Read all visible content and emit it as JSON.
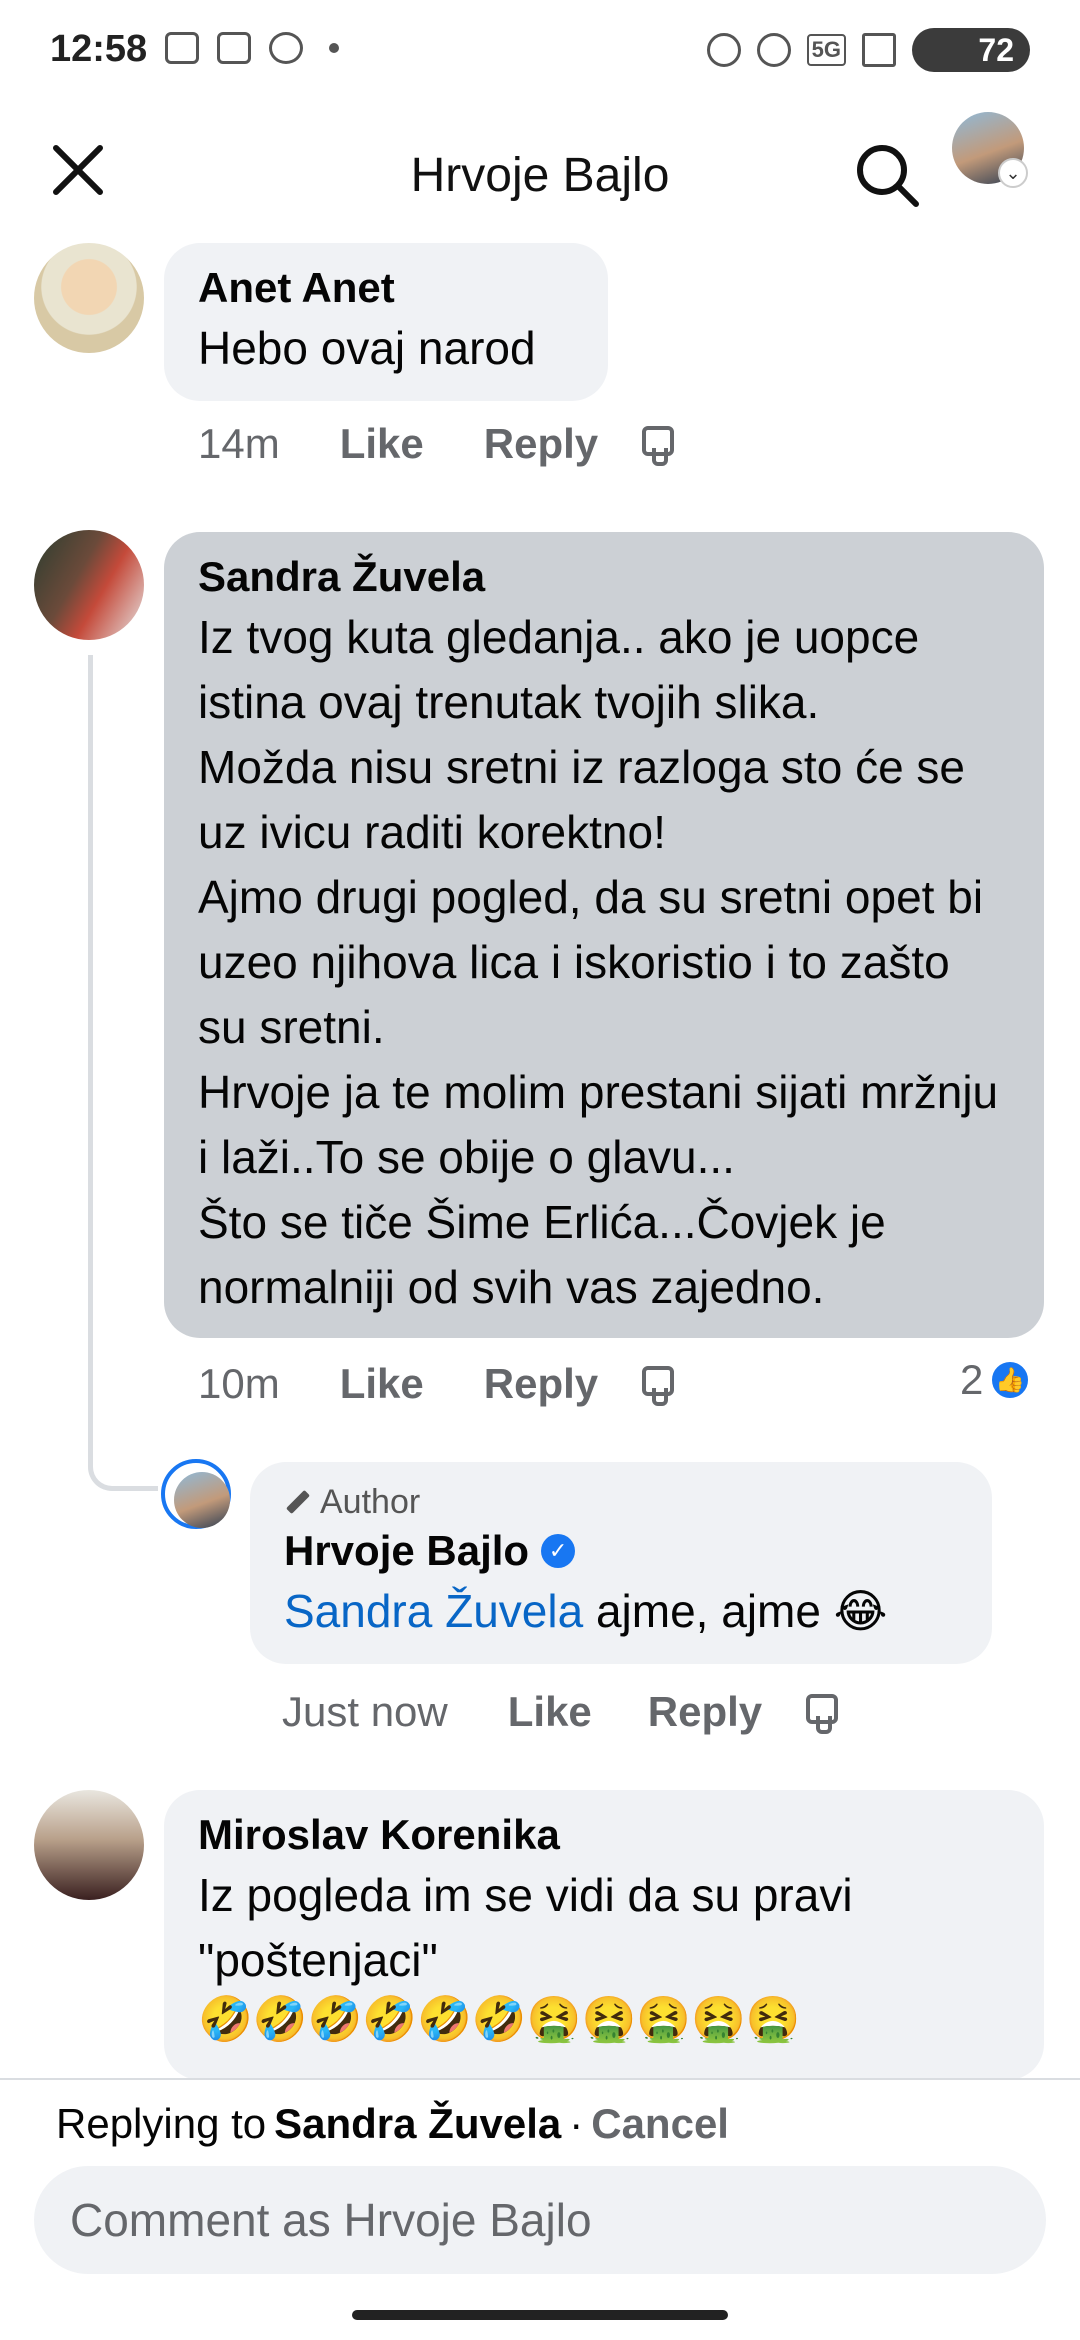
{
  "status_bar": {
    "time": "12:58",
    "battery": "72",
    "network_label": "5G"
  },
  "header": {
    "title": "Hrvoje Bajlo"
  },
  "comments": [
    {
      "author": "Anet Anet",
      "text": "Hebo ovaj narod",
      "time": "14m",
      "like_label": "Like",
      "reply_label": "Reply"
    },
    {
      "author": "Sandra Žuvela",
      "text": "Iz tvog kuta gledanja.. ako je uopce istina ovaj trenutak tvojih slika.\nMožda nisu sretni iz razloga sto će se uz ivicu raditi korektno!\nAjmo drugi pogled, da su sretni opet bi uzeo njihova lica i iskoristio i to zašto su sretni.\nHrvoje ja te molim prestani sijati mržnju i laži..To se obije o glavu...\nŠto se tiče Šime Erlića...Čovjek  je normalniji od svih vas zajedno.",
      "time": "10m",
      "like_label": "Like",
      "reply_label": "Reply",
      "reaction_count": "2"
    },
    {
      "badge": "Author",
      "author": "Hrvoje Bajlo",
      "mention": "Sandra Žuvela",
      "text": " ajme, ajme 😂",
      "time": "Just now",
      "like_label": "Like",
      "reply_label": "Reply"
    },
    {
      "author": "Miroslav Korenika",
      "text": "Iz pogleda im se vidi da su pravi \"poštenjaci\"",
      "emojis": "🤣🤣🤣🤣🤣🤣🤮🤮🤮🤮🤮"
    }
  ],
  "reply_bar": {
    "prefix": "Replying to",
    "target": "Sandra Žuvela",
    "separator": "·",
    "cancel": "Cancel",
    "placeholder": "Comment as Hrvoje Bajlo"
  },
  "icons": {
    "close": "close-icon",
    "search": "search-icon",
    "dislike": "thumbs-down-icon",
    "like": "thumbs-up-icon",
    "verified": "verified-badge-icon",
    "pen": "pen-icon"
  },
  "colors": {
    "accent": "#1877f2",
    "mention": "#0866c6",
    "bubble": "#f0f2f5",
    "bubble_highlight": "#ccd0d5",
    "muted_text": "#65676b"
  }
}
